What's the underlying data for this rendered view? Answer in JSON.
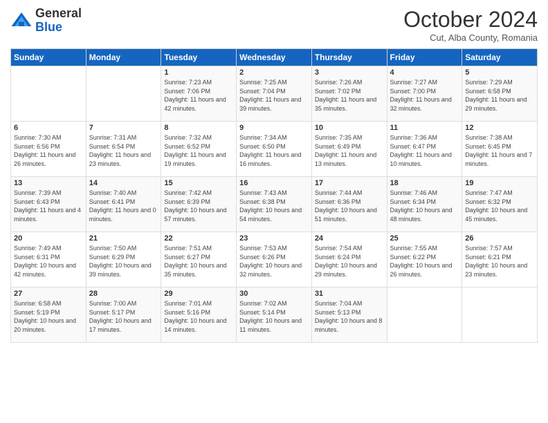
{
  "header": {
    "logo_general": "General",
    "logo_blue": "Blue",
    "month": "October 2024",
    "location": "Cut, Alba County, Romania"
  },
  "days_of_week": [
    "Sunday",
    "Monday",
    "Tuesday",
    "Wednesday",
    "Thursday",
    "Friday",
    "Saturday"
  ],
  "weeks": [
    [
      {
        "num": "",
        "info": ""
      },
      {
        "num": "",
        "info": ""
      },
      {
        "num": "1",
        "info": "Sunrise: 7:23 AM\nSunset: 7:06 PM\nDaylight: 11 hours and 42 minutes."
      },
      {
        "num": "2",
        "info": "Sunrise: 7:25 AM\nSunset: 7:04 PM\nDaylight: 11 hours and 39 minutes."
      },
      {
        "num": "3",
        "info": "Sunrise: 7:26 AM\nSunset: 7:02 PM\nDaylight: 11 hours and 35 minutes."
      },
      {
        "num": "4",
        "info": "Sunrise: 7:27 AM\nSunset: 7:00 PM\nDaylight: 11 hours and 32 minutes."
      },
      {
        "num": "5",
        "info": "Sunrise: 7:29 AM\nSunset: 6:58 PM\nDaylight: 11 hours and 29 minutes."
      }
    ],
    [
      {
        "num": "6",
        "info": "Sunrise: 7:30 AM\nSunset: 6:56 PM\nDaylight: 11 hours and 26 minutes."
      },
      {
        "num": "7",
        "info": "Sunrise: 7:31 AM\nSunset: 6:54 PM\nDaylight: 11 hours and 23 minutes."
      },
      {
        "num": "8",
        "info": "Sunrise: 7:32 AM\nSunset: 6:52 PM\nDaylight: 11 hours and 19 minutes."
      },
      {
        "num": "9",
        "info": "Sunrise: 7:34 AM\nSunset: 6:50 PM\nDaylight: 11 hours and 16 minutes."
      },
      {
        "num": "10",
        "info": "Sunrise: 7:35 AM\nSunset: 6:49 PM\nDaylight: 11 hours and 13 minutes."
      },
      {
        "num": "11",
        "info": "Sunrise: 7:36 AM\nSunset: 6:47 PM\nDaylight: 11 hours and 10 minutes."
      },
      {
        "num": "12",
        "info": "Sunrise: 7:38 AM\nSunset: 6:45 PM\nDaylight: 11 hours and 7 minutes."
      }
    ],
    [
      {
        "num": "13",
        "info": "Sunrise: 7:39 AM\nSunset: 6:43 PM\nDaylight: 11 hours and 4 minutes."
      },
      {
        "num": "14",
        "info": "Sunrise: 7:40 AM\nSunset: 6:41 PM\nDaylight: 11 hours and 0 minutes."
      },
      {
        "num": "15",
        "info": "Sunrise: 7:42 AM\nSunset: 6:39 PM\nDaylight: 10 hours and 57 minutes."
      },
      {
        "num": "16",
        "info": "Sunrise: 7:43 AM\nSunset: 6:38 PM\nDaylight: 10 hours and 54 minutes."
      },
      {
        "num": "17",
        "info": "Sunrise: 7:44 AM\nSunset: 6:36 PM\nDaylight: 10 hours and 51 minutes."
      },
      {
        "num": "18",
        "info": "Sunrise: 7:46 AM\nSunset: 6:34 PM\nDaylight: 10 hours and 48 minutes."
      },
      {
        "num": "19",
        "info": "Sunrise: 7:47 AM\nSunset: 6:32 PM\nDaylight: 10 hours and 45 minutes."
      }
    ],
    [
      {
        "num": "20",
        "info": "Sunrise: 7:49 AM\nSunset: 6:31 PM\nDaylight: 10 hours and 42 minutes."
      },
      {
        "num": "21",
        "info": "Sunrise: 7:50 AM\nSunset: 6:29 PM\nDaylight: 10 hours and 39 minutes."
      },
      {
        "num": "22",
        "info": "Sunrise: 7:51 AM\nSunset: 6:27 PM\nDaylight: 10 hours and 35 minutes."
      },
      {
        "num": "23",
        "info": "Sunrise: 7:53 AM\nSunset: 6:26 PM\nDaylight: 10 hours and 32 minutes."
      },
      {
        "num": "24",
        "info": "Sunrise: 7:54 AM\nSunset: 6:24 PM\nDaylight: 10 hours and 29 minutes."
      },
      {
        "num": "25",
        "info": "Sunrise: 7:55 AM\nSunset: 6:22 PM\nDaylight: 10 hours and 26 minutes."
      },
      {
        "num": "26",
        "info": "Sunrise: 7:57 AM\nSunset: 6:21 PM\nDaylight: 10 hours and 23 minutes."
      }
    ],
    [
      {
        "num": "27",
        "info": "Sunrise: 6:58 AM\nSunset: 5:19 PM\nDaylight: 10 hours and 20 minutes."
      },
      {
        "num": "28",
        "info": "Sunrise: 7:00 AM\nSunset: 5:17 PM\nDaylight: 10 hours and 17 minutes."
      },
      {
        "num": "29",
        "info": "Sunrise: 7:01 AM\nSunset: 5:16 PM\nDaylight: 10 hours and 14 minutes."
      },
      {
        "num": "30",
        "info": "Sunrise: 7:02 AM\nSunset: 5:14 PM\nDaylight: 10 hours and 11 minutes."
      },
      {
        "num": "31",
        "info": "Sunrise: 7:04 AM\nSunset: 5:13 PM\nDaylight: 10 hours and 8 minutes."
      },
      {
        "num": "",
        "info": ""
      },
      {
        "num": "",
        "info": ""
      }
    ]
  ]
}
